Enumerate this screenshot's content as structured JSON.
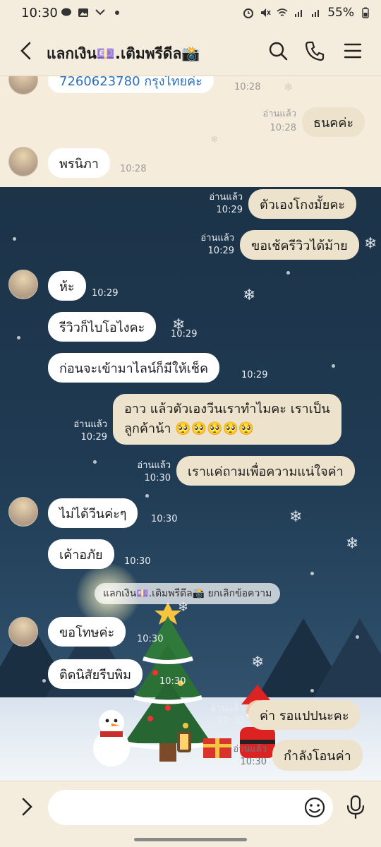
{
  "status_bar": {
    "time": "10:30",
    "battery": "55%"
  },
  "header": {
    "title": "แลกเงิน💷.เติมพรีดีล📸"
  },
  "messages": [
    {
      "text": "7260623780 กรุงไทยค่ะ",
      "time": "10:28"
    },
    {
      "text": "ธนคค่ะ",
      "read": "อ่านแล้ว",
      "time": "10:28"
    },
    {
      "text": "พรนิภา",
      "time": "10:28"
    },
    {
      "text": "ตัวเองโกงมั้ยคะ",
      "read": "อ่านแล้ว",
      "time": "10:29"
    },
    {
      "text": "ขอเช้ครีวิวได้ม้าย",
      "read": "อ่านแล้ว",
      "time": "10:29"
    },
    {
      "text": "ห้ะ",
      "time": "10:29"
    },
    {
      "text": "รีวิวก็ไบโอไงคะ",
      "time": "10:29"
    },
    {
      "text": "ก่อนจะเข้ามาไลน์ก็มีให้เช็ค",
      "time": "10:29"
    },
    {
      "line1": "อาว แล้วตัวเองวีนเราทำไมคะ เราเป็น",
      "line2": "ลูกค้าน้า 🥺🥺🥺🥺🥺",
      "read": "อ่านแล้ว",
      "time": "10:29"
    },
    {
      "text": "เราแค่ถามเพื่อความแน่ใจค่า",
      "read": "อ่านแล้ว",
      "time": "10:30"
    },
    {
      "text": "ไม่ได้วีนค่ะๆ",
      "time": "10:30"
    },
    {
      "text": "เค้าอภัย",
      "time": "10:30"
    },
    {
      "text": "ขอโทษค่ะ",
      "time": "10:30"
    },
    {
      "text": "ติดนิสัยรีบพิม",
      "time": "10:30"
    },
    {
      "text": "ค่า รอแปปนะคะ",
      "read": "อ่านแล้ว",
      "time": "10:30"
    },
    {
      "text": "กำลังโอนค่า",
      "read": "อ่านแล้ว",
      "time": "10:30"
    }
  ],
  "system_notice": "แลกเงิน💷.เติมพรีดีล📸 ยกเลิกข้อความ",
  "input": {
    "value": ""
  },
  "colors": {
    "header_bg": "#f4ecdd",
    "incoming_bubble": "#ffffff",
    "outgoing_bubble": "#ede3cc",
    "night_sky": "#1f3a52"
  },
  "icons": [
    "back-icon",
    "search-icon",
    "phone-icon",
    "menu-icon",
    "expand-icon",
    "emoji-icon",
    "mic-icon"
  ]
}
